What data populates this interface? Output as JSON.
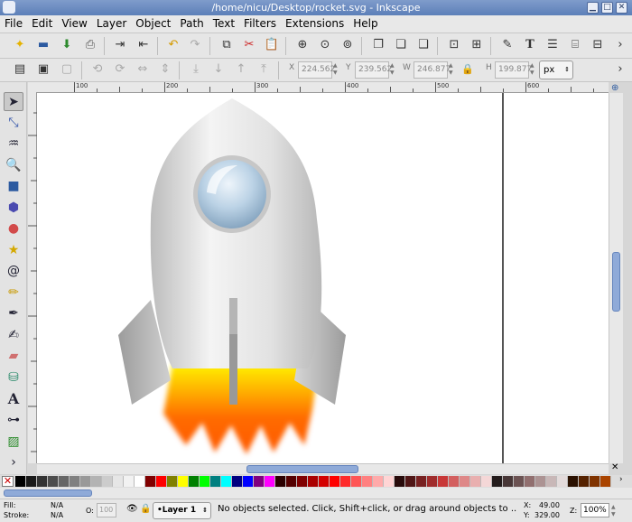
{
  "window": {
    "title": "/home/nicu/Desktop/rocket.svg - Inkscape"
  },
  "menu": [
    "File",
    "Edit",
    "View",
    "Layer",
    "Object",
    "Path",
    "Text",
    "Filters",
    "Extensions",
    "Help"
  ],
  "coords": {
    "x_label": "X",
    "x_value": "224.562",
    "y_label": "Y",
    "y_value": "239.562",
    "w_label": "W",
    "w_value": "246.877",
    "h_label": "H",
    "h_value": "199.877",
    "unit": "px"
  },
  "ruler_numbers": [
    "100",
    "200",
    "300",
    "400",
    "500",
    "600"
  ],
  "palette_colors": [
    "#000000",
    "#1a1a1a",
    "#333333",
    "#4d4d4d",
    "#666666",
    "#808080",
    "#999999",
    "#b3b3b3",
    "#cccccc",
    "#e6e6e6",
    "#f2f2f2",
    "#ffffff",
    "#800000",
    "#ff0000",
    "#808000",
    "#ffff00",
    "#008000",
    "#00ff00",
    "#008080",
    "#00ffff",
    "#000080",
    "#0000ff",
    "#800080",
    "#ff00ff",
    "#2b0000",
    "#550000",
    "#800000",
    "#aa0000",
    "#d40000",
    "#ff0000",
    "#ff2a2a",
    "#ff5555",
    "#ff8080",
    "#ffaaaa",
    "#ffd5d5",
    "#280b0b",
    "#501616",
    "#782121",
    "#a02c2c",
    "#c83737",
    "#d35f5f",
    "#de8787",
    "#e9afaf",
    "#f4d7d7",
    "#241c1c",
    "#483737",
    "#6c5353",
    "#916f6f",
    "#ac9393",
    "#c8b7b7",
    "#e3dbdb",
    "#2b1100",
    "#552200",
    "#803300",
    "#aa4400"
  ],
  "status": {
    "fill_label": "Fill:",
    "fill_value": "N/A",
    "stroke_label": "Stroke:",
    "stroke_value": "N/A",
    "opacity_label": "O:",
    "opacity_value": "100",
    "layer": "•Layer 1",
    "message": "No objects selected. Click, Shift+click, or drag around objects to ...",
    "x_label": "X:",
    "x_value": "49.00",
    "y_label": "Y:",
    "y_value": "329.00",
    "zoom_label": "Z:",
    "zoom_value": "100%"
  }
}
